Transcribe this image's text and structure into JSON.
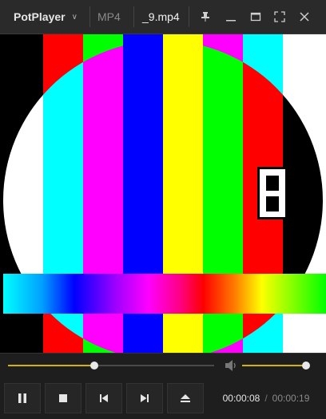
{
  "titlebar": {
    "app_name": "PotPlayer",
    "app_menu_icon": "chevron-down-icon",
    "format": "MP4",
    "filename": "_9.mp4",
    "buttons": [
      "pin-icon",
      "minimize-icon",
      "maximize-icon",
      "fullscreen-icon",
      "close-icon"
    ]
  },
  "video": {
    "colors": {
      "white": "#ffffff",
      "yellow": "#ffff00",
      "cyan": "#00ffff",
      "green": "#00ff00",
      "magenta": "#ff00ff",
      "red": "#ff0000",
      "blue": "#0000ff",
      "black": "#000000"
    },
    "counter_digit": "8"
  },
  "seek": {
    "progress": 0.42,
    "accent": "#d4b200"
  },
  "volume": {
    "level": 1.0,
    "icon": "speaker-icon"
  },
  "controls": {
    "buttons": [
      "pause-icon",
      "stop-icon",
      "previous-icon",
      "next-icon",
      "eject-icon"
    ],
    "current_time": "00:00:08",
    "total_time": "00:00:19"
  }
}
